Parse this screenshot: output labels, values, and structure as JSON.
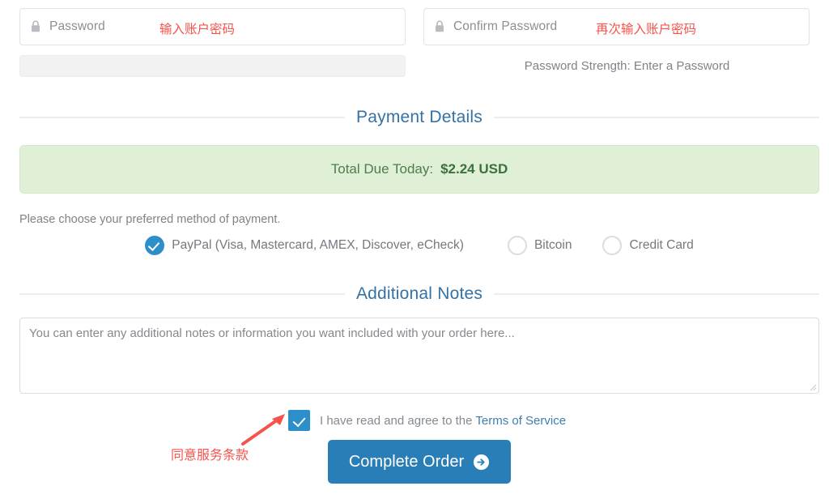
{
  "password_section": {
    "password_field": {
      "icon": "lock-icon",
      "placeholder": "Password",
      "annotation_cn": "输入账户密码"
    },
    "confirm_field": {
      "icon": "lock-icon",
      "placeholder": "Confirm Password",
      "annotation_cn": "再次输入账户密码"
    },
    "strength_bar_value": "",
    "strength_label": "Password Strength: Enter a Password"
  },
  "payment_section": {
    "legend": "Payment Details",
    "total_label": "Total Due Today:",
    "total_amount": "$2.24 USD",
    "instruction": "Please choose your preferred method of payment.",
    "methods": [
      {
        "label": "PayPal (Visa, Mastercard, AMEX, Discover, eCheck)",
        "selected": true
      },
      {
        "label": "Bitcoin",
        "selected": false
      },
      {
        "label": "Credit Card",
        "selected": false
      }
    ]
  },
  "notes_section": {
    "legend": "Additional Notes",
    "placeholder": "You can enter any additional notes or information you want included with your order here...",
    "value": ""
  },
  "terms_section": {
    "checkbox_checked": true,
    "text_before_link": "I have read and agree to the ",
    "link_text": "Terms of Service",
    "annotation_cn": "同意服务条款"
  },
  "submit": {
    "label": "Complete Order",
    "icon": "arrow-circle-right-icon"
  },
  "colors": {
    "accent_blue": "#2a7eb8",
    "radio_blue": "#2d8fc9",
    "legend_blue": "#3472a5",
    "link_blue": "#3b7fb0",
    "success_bg": "#dff0d7",
    "success_text": "#3c703c",
    "annotation_red": "#f5544c",
    "muted_text": "#7d8389"
  }
}
